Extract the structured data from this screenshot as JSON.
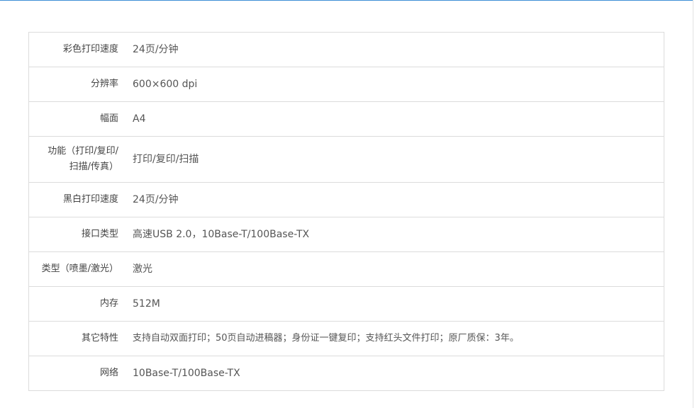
{
  "specs": [
    {
      "label": "彩色打印速度",
      "value": "24页/分钟"
    },
    {
      "label": "分辨率",
      "value": "600×600 dpi"
    },
    {
      "label": "幅面",
      "value": "A4"
    },
    {
      "label_line1": "功能（打印/复印/",
      "label_line2": "扫描/传真）",
      "value": "打印/复印/扫描"
    },
    {
      "label": "黑白打印速度",
      "value": "24页/分钟"
    },
    {
      "label": "接口类型",
      "value": "高速USB 2.0，10Base-T/100Base-TX"
    },
    {
      "label": "类型（喷墨/激光）",
      "value": "激光"
    },
    {
      "label": "内存",
      "value": "512M"
    },
    {
      "label": "其它特性",
      "value": "支持自动双面打印；50页自动进稿器；身份证一键复印；支持红头文件打印；原厂质保：3年。"
    },
    {
      "label": "网络",
      "value": "10Base-T/100Base-TX"
    }
  ]
}
